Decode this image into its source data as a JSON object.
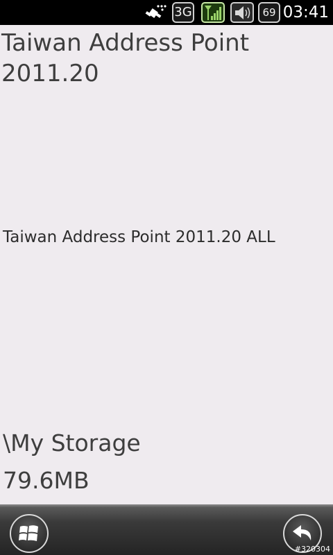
{
  "status_bar": {
    "network_type": "3G",
    "battery_level": "69",
    "time": "03:41",
    "icons": [
      "gps-satellite-icon",
      "network-3g-icon",
      "signal-strength-icon",
      "volume-icon",
      "battery-icon"
    ],
    "signal_color": "#9bd36a"
  },
  "main": {
    "title": "Taiwan Address Point 2011.20",
    "package_name": "Taiwan Address Point 2011.20 ALL",
    "storage_location": "\\My Storage",
    "storage_size": "79.6MB"
  },
  "bottom_bar": {
    "start_icon": "windows-flag-icon",
    "back_icon": "back-arrow-icon"
  },
  "watermark": "#320304"
}
